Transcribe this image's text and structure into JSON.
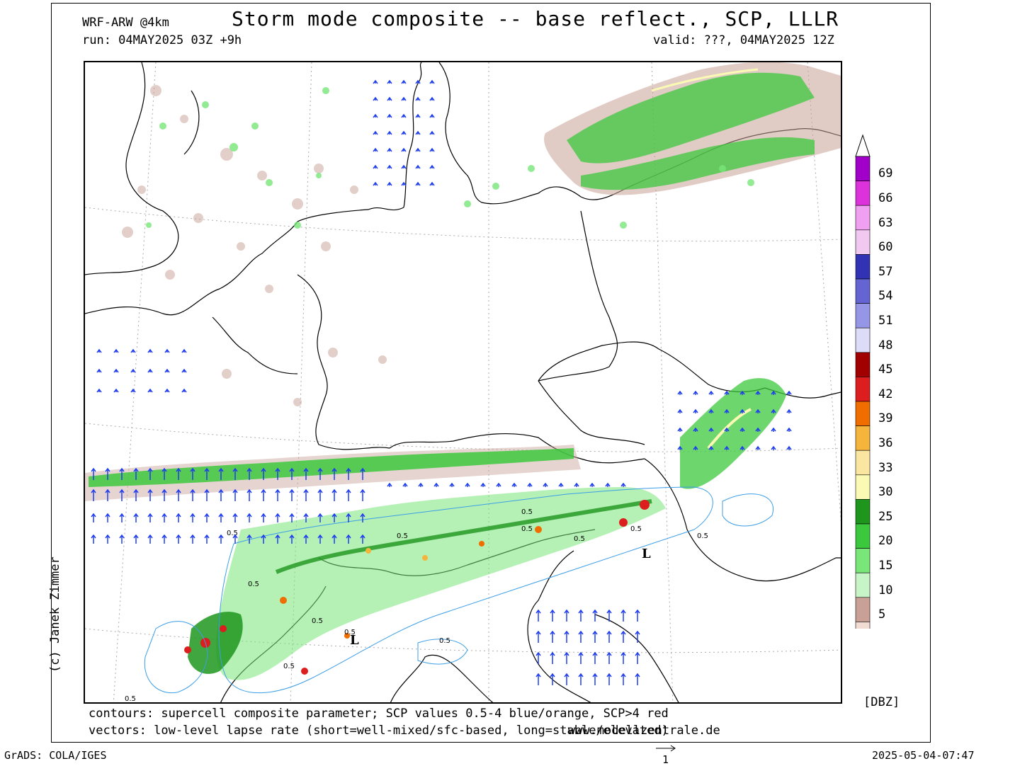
{
  "header": {
    "title": "Storm mode composite -- base reflect., SCP, LLLR",
    "model": "WRF-ARW @4km",
    "run": "run: 04MAY2025 03Z +9h",
    "valid": "valid: ???, 04MAY2025 12Z"
  },
  "footer": {
    "note_contours": "contours: supercell composite parameter; SCP values 0.5-4 blue/orange, SCP>4 red",
    "note_vectors": "vectors: low-level lapse rate (short=well-mixed/sfc-based, long=stable/elevated)",
    "website": "www.modellzentrale.de",
    "grads": "GrADS: COLA/IGES",
    "timestamp": "2025-05-04-07:47",
    "vector_scale": "1",
    "credit": "(c) Janek Zimmer"
  },
  "legend": {
    "units": "[DBZ]",
    "levels": [
      69,
      66,
      63,
      60,
      57,
      54,
      51,
      48,
      45,
      42,
      39,
      36,
      33,
      30,
      25,
      20,
      15,
      10,
      5
    ],
    "colors": [
      "#a000c8",
      "#dc32dc",
      "#f0a0f0",
      "#f0c8f0",
      "#3232b4",
      "#6464d2",
      "#9696e6",
      "#dcdcf8",
      "#a00000",
      "#dc1e1e",
      "#f06e00",
      "#f5b43c",
      "#fae6a0",
      "#fafab4",
      "#1e961e",
      "#3cc83c",
      "#78e678",
      "#c8f5c8",
      "#c8a096",
      "#f0dcd2"
    ]
  },
  "map": {
    "contour_labels": [
      "0.5",
      "0.5",
      "0.5",
      "0.5",
      "0.5",
      "0.5",
      "0.5",
      "0.5",
      "0.5",
      "0.5",
      "0.5",
      "0.5",
      "0.5"
    ],
    "low_markers": [
      "L",
      "L"
    ]
  }
}
